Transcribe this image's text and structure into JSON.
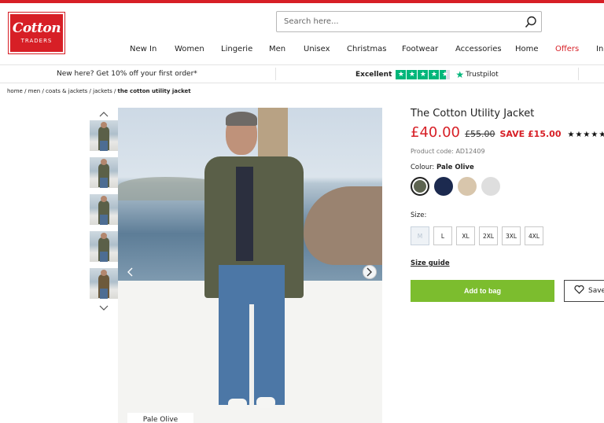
{
  "header": {
    "logo_line1": "Cotton",
    "logo_line2": "TRADERS",
    "search_placeholder": "Search here...",
    "search_icon": "search-icon"
  },
  "nav": {
    "items": [
      "New In",
      "Women",
      "Lingerie",
      "Men",
      "Unisex",
      "Christmas",
      "Footwear",
      "Accessories",
      "Home",
      "Offers",
      "In"
    ]
  },
  "promo": {
    "left": "New here? Get 10% off your first order*",
    "trustpilot_rating": "Excellent",
    "trustpilot_label": "Trustpilot"
  },
  "breadcrumb": {
    "path": "home / men / coats & jackets / jackets / ",
    "current": "the cotton utility jacket"
  },
  "gallery": {
    "colour_tag": "Pale Olive",
    "thumb_count": 5
  },
  "product": {
    "title": "The Cotton Utility Jacket",
    "price_now": "£40.00",
    "price_was": "£55.00",
    "save": "SAVE £15.00",
    "stars": "★★★★★",
    "code": "Product code: AD12409",
    "colour_label": "Colour: ",
    "colour_value": "Pale Olive",
    "swatches": [
      "#5d6450",
      "#1c2a4f",
      "#d8c6ac",
      "#dedede"
    ],
    "size_label": "Size:",
    "sizes": [
      "M",
      "L",
      "XL",
      "2XL",
      "3XL",
      "4XL"
    ],
    "size_guide": "Size guide",
    "add_to_bag": "Add to bag",
    "save_label": "Save"
  },
  "colors": {
    "brand": "#d71f26",
    "add_bag": "#7cbd2e",
    "trustpilot": "#00b67a"
  }
}
